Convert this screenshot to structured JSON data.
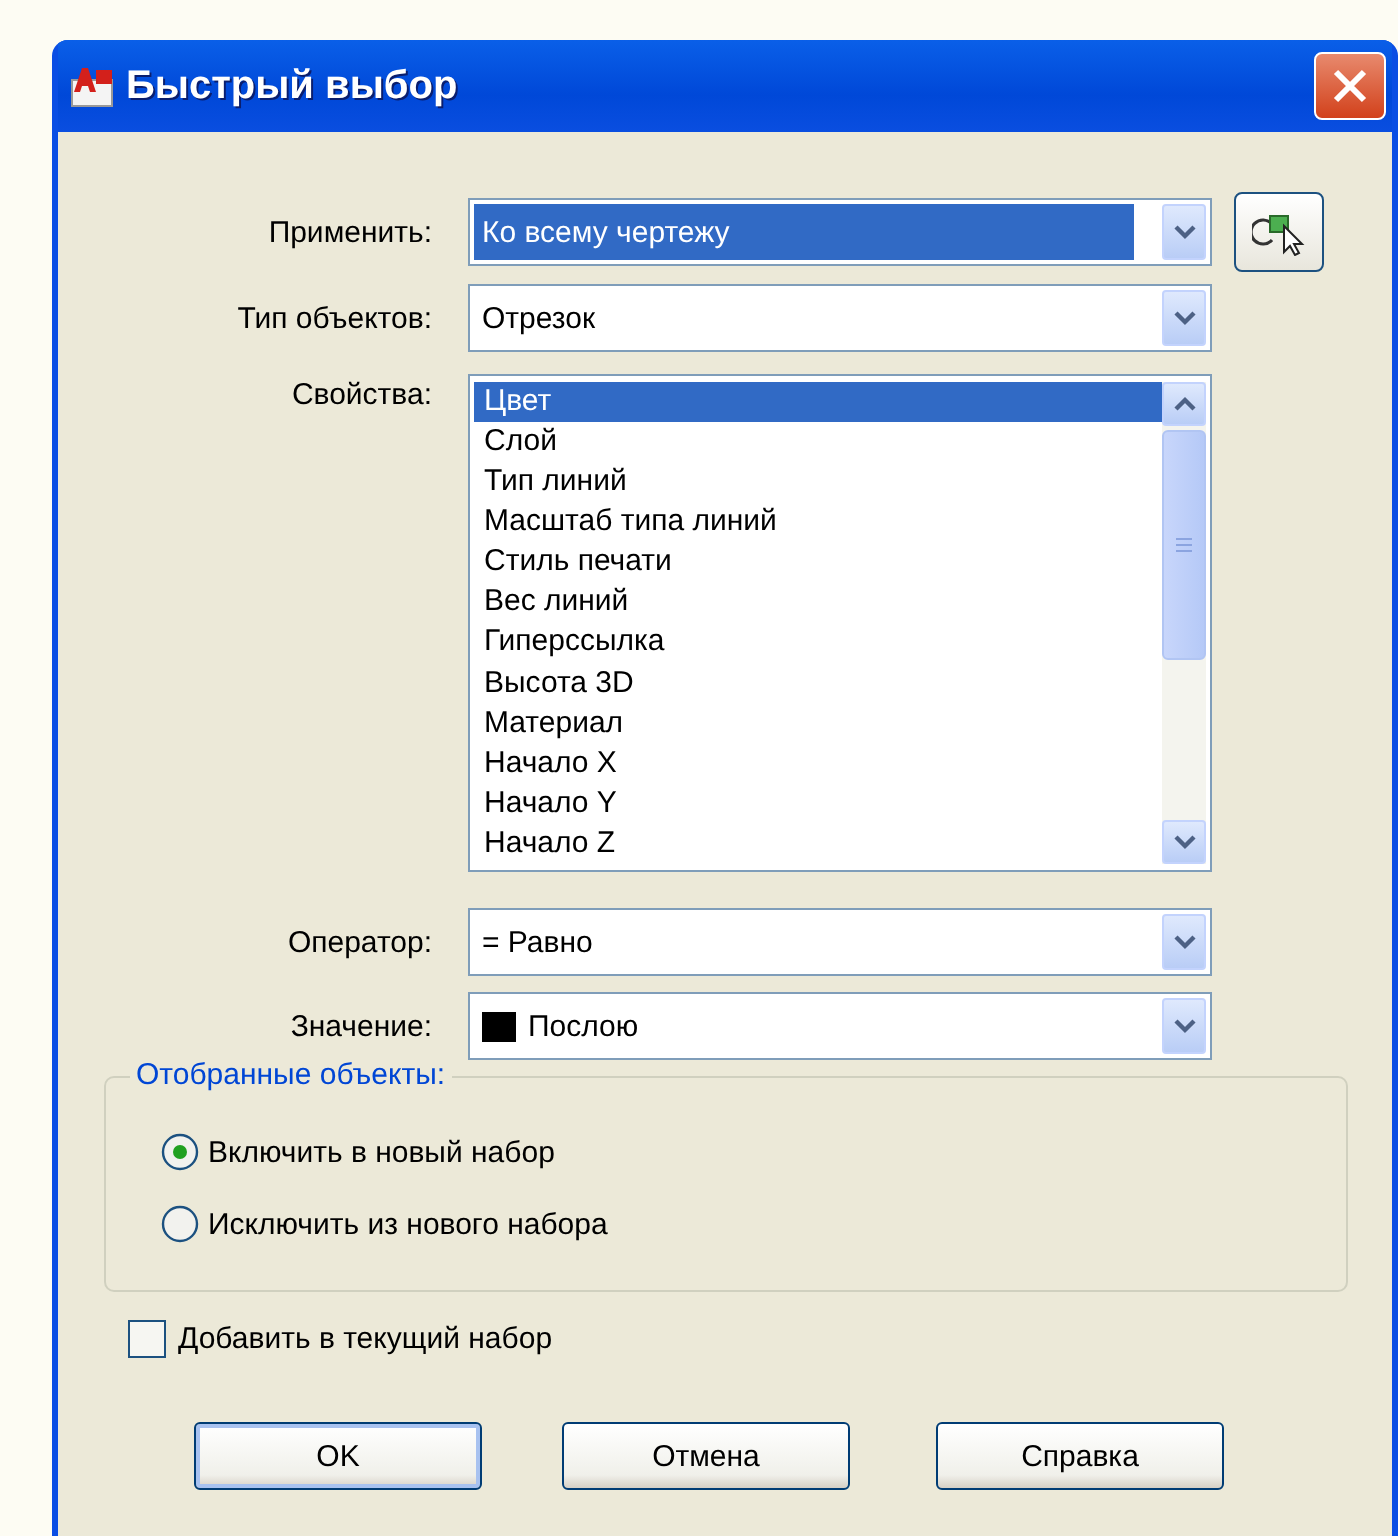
{
  "window": {
    "title": "Быстрый выбор"
  },
  "fields": [
    {
      "label": "Применить:",
      "kind": "combo",
      "value": "Ко всему чертежу",
      "focused": true,
      "pick_button": true
    },
    {
      "label": "Тип объектов:",
      "kind": "combo",
      "value": "Отрезок",
      "focused": false
    },
    {
      "label": "Свойства:",
      "kind": "list",
      "items": [
        {
          "text": "Цвет",
          "selected": true
        },
        {
          "text": "Слой",
          "selected": false
        },
        {
          "text": "Тип линий",
          "selected": false
        },
        {
          "text": "Масштаб типа линий",
          "selected": false
        },
        {
          "text": "Стиль печати",
          "selected": false
        },
        {
          "text": "Вес линий",
          "selected": false
        },
        {
          "text": "Гиперссылка",
          "selected": false
        },
        {
          "text": "Высота 3D",
          "selected": false
        },
        {
          "text": "Материал",
          "selected": false
        },
        {
          "text": "Начало X",
          "selected": false
        },
        {
          "text": "Начало Y",
          "selected": false
        },
        {
          "text": "Начало Z",
          "selected": false
        }
      ]
    },
    {
      "label": "Оператор:",
      "kind": "combo",
      "value": "= Равно",
      "focused": false
    },
    {
      "label": "Значение:",
      "kind": "color-combo",
      "value": "Послою",
      "focused": false
    }
  ],
  "selected_objects": {
    "title": "Отобранные объекты:",
    "options": [
      {
        "label": "Включить в новый набор",
        "selected": true
      },
      {
        "label": "Исключить из нового набора",
        "selected": false
      }
    ]
  },
  "append_checkbox": {
    "label": "Добавить в текущий набор",
    "checked": false
  },
  "buttons": [
    {
      "label": "OK",
      "default": true
    },
    {
      "label": "Отмена",
      "default": false
    },
    {
      "label": "Справка",
      "default": false
    }
  ]
}
